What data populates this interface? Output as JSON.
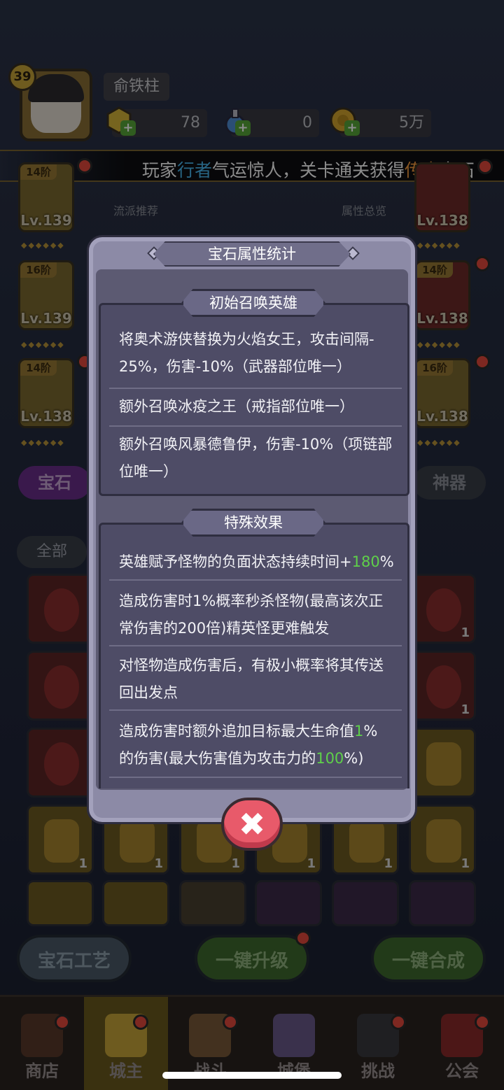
{
  "player": {
    "level": "39",
    "name": "俞铁柱",
    "resources": [
      {
        "icon": "gold-gem-icon",
        "value": "78"
      },
      {
        "icon": "potion-icon",
        "value": "0"
      },
      {
        "icon": "coin-icon",
        "value": "5万"
      }
    ]
  },
  "announcement": {
    "part1": "玩家",
    "part2": "行者",
    "part3": "气运惊人，关卡通关获得",
    "part4": "传奇",
    "part5": "宝石"
  },
  "side_labels": {
    "left": "流派推荐",
    "right": "属性总览"
  },
  "equipment": {
    "left": [
      {
        "stage": "14阶",
        "level": "Lv.139"
      },
      {
        "stage": "16阶",
        "level": "Lv.139"
      },
      {
        "stage": "14阶",
        "level": "Lv.138"
      }
    ],
    "right": [
      {
        "stage": "",
        "level": "Lv.138"
      },
      {
        "stage": "14阶",
        "level": "Lv.138"
      },
      {
        "stage": "16阶",
        "level": "Lv.138"
      }
    ]
  },
  "tabs": {
    "gem": "宝石",
    "artifact": "神器"
  },
  "filter": {
    "all": "全部"
  },
  "gem_counts": [
    "1",
    "1",
    "1",
    "1",
    "1",
    "1",
    "1",
    "1"
  ],
  "modal": {
    "title": "宝石属性统计",
    "section1": {
      "header": "初始召唤英雄",
      "entries": [
        {
          "line1": "将奥术游侠替换为火焰女王，攻击间隔-",
          "line2": "25%，伤害-10%（武器部位唯一）"
        },
        {
          "line1": "额外召唤冰疫之王（戒指部位唯一）"
        },
        {
          "line1": "额外召唤风暴德鲁伊，伤害-10%（项链部",
          "line2": "位唯一）"
        }
      ]
    },
    "section2": {
      "header": "特殊效果",
      "e1_text": "英雄赋予怪物的负面状态持续时间+",
      "e1_value": "180",
      "e1_suffix": "%",
      "e2_line1": "造成伤害时1%概率秒杀怪物(最高该次正",
      "e2_line2": "常伤害的200倍)精英怪更难触发",
      "e3_line1": "对怪物造成伤害后，有极小概率将其传送",
      "e3_line2": "回出发点",
      "e4_pre": "造成伤害时额外追加目标最大生命值",
      "e4_val1": "1",
      "e4_mid": "%",
      "e4_line2_pre": "的伤害(最大伤害值为攻击力的",
      "e4_val2": "100",
      "e4_suffix": "%)"
    }
  },
  "buttons": {
    "craft": "宝石工艺",
    "upgrade": "一键升级",
    "merge": "一键合成"
  },
  "nav": [
    {
      "label": "商店",
      "icon": "shop-icon"
    },
    {
      "label": "城主",
      "icon": "crown-icon"
    },
    {
      "label": "战斗",
      "icon": "swords-icon"
    },
    {
      "label": "城堡",
      "icon": "castle-icon"
    },
    {
      "label": "挑战",
      "icon": "demon-icon"
    },
    {
      "label": "公会",
      "icon": "banner-icon"
    }
  ],
  "colors": {
    "highlight_blue": "#49b8f0",
    "highlight_orange": "#f59a3c",
    "value_green": "#5fd04a",
    "notification_red": "#e64a3c"
  }
}
